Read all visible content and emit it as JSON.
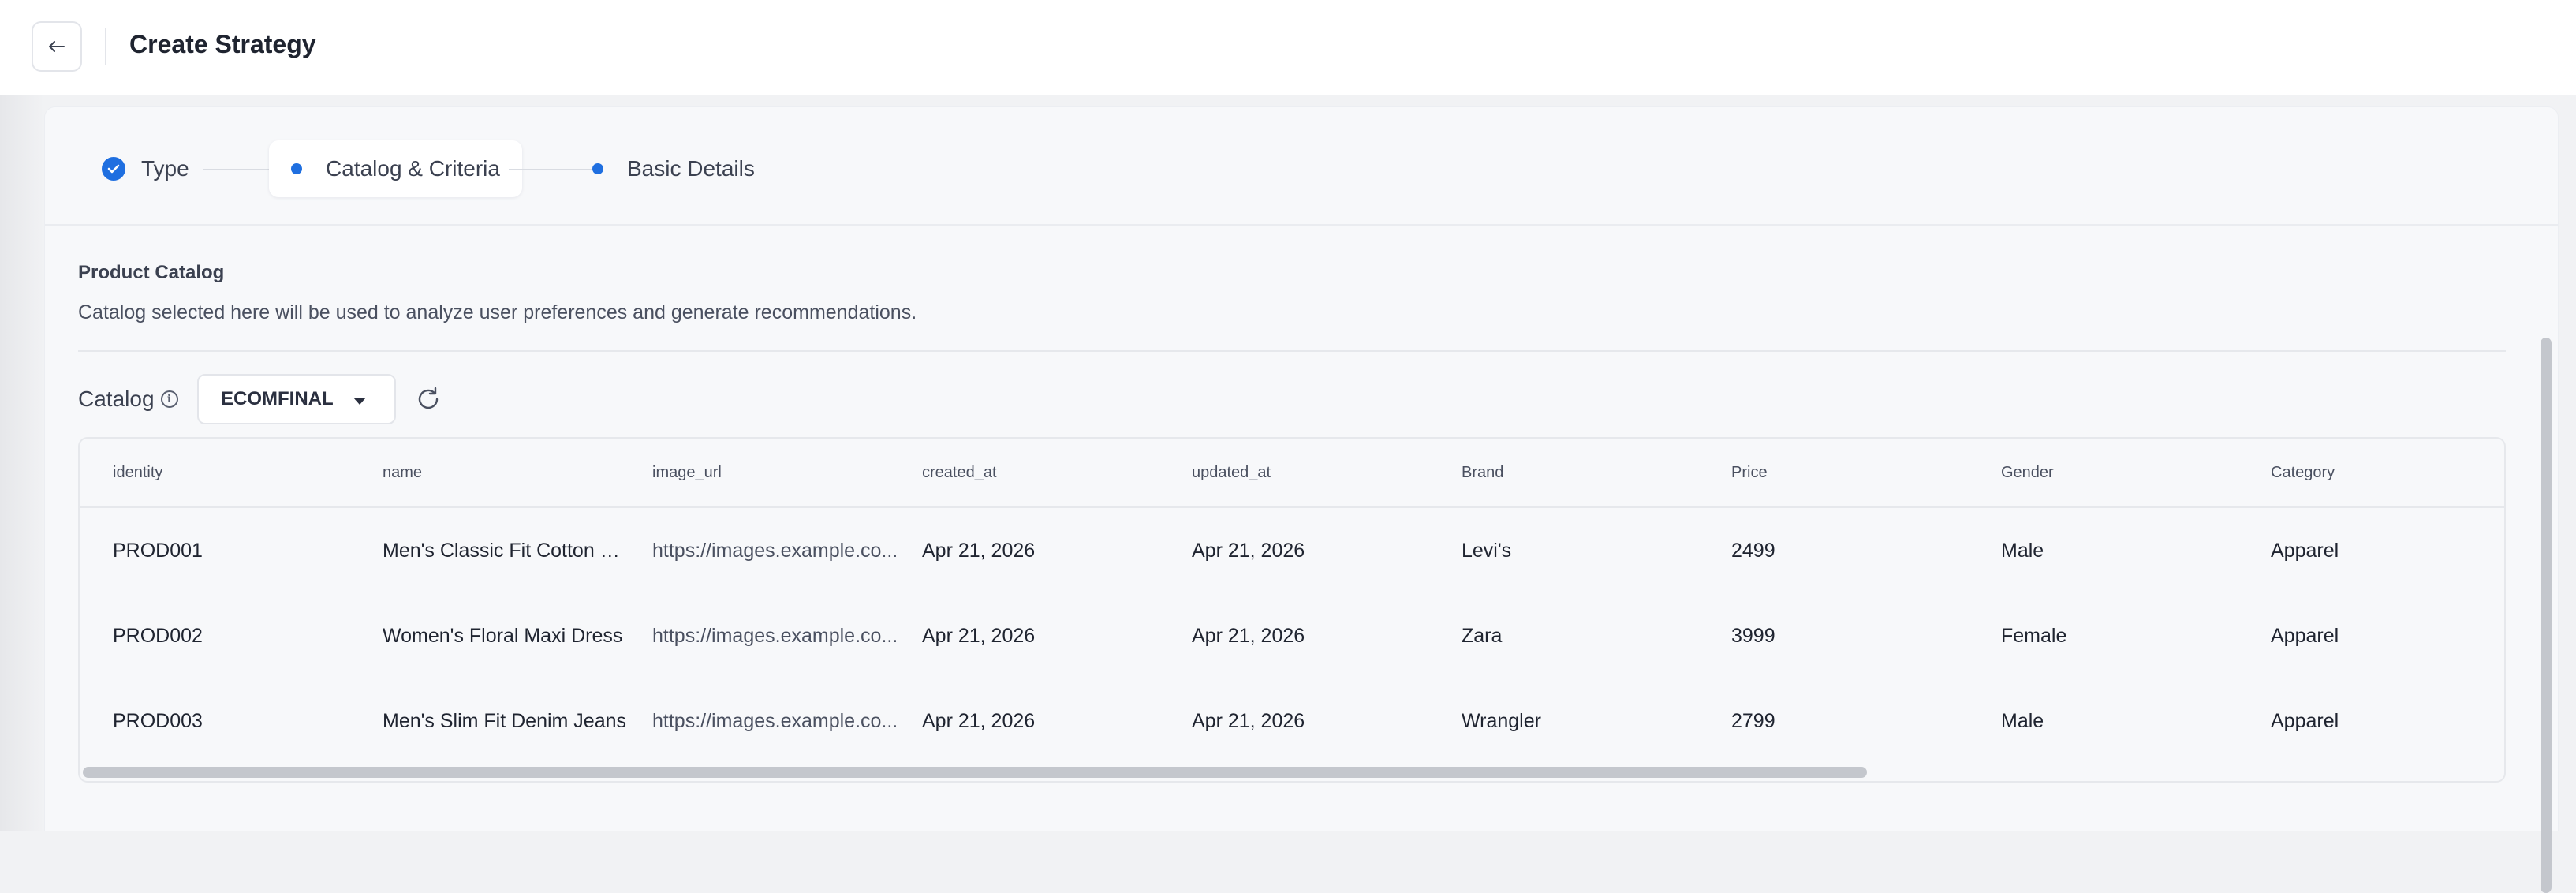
{
  "header": {
    "back_icon": "arrow-left-icon",
    "title": "Create Strategy"
  },
  "stepper": {
    "steps": [
      {
        "label": "Type",
        "status": "completed"
      },
      {
        "label": "Catalog & Criteria",
        "status": "active"
      },
      {
        "label": "Basic Details",
        "status": "pending"
      }
    ]
  },
  "product_catalog": {
    "title": "Product Catalog",
    "description": "Catalog selected here will be used to analyze user preferences and generate recommendations.",
    "catalog_label": "Catalog",
    "info_icon": "info-icon",
    "selected_catalog": "ECOMFINAL",
    "refresh_icon": "refresh-icon"
  },
  "table": {
    "columns": [
      "identity",
      "name",
      "image_url",
      "created_at",
      "updated_at",
      "Brand",
      "Price",
      "Gender",
      "Category"
    ],
    "rows": [
      [
        "PROD001",
        "Men's Classic Fit Cotton S...",
        "https://images.example.co...",
        "Apr 21, 2026",
        "Apr 21, 2026",
        "Levi's",
        "2499",
        "Male",
        "Apparel"
      ],
      [
        "PROD002",
        "Women's Floral Maxi Dress",
        "https://images.example.co...",
        "Apr 21, 2026",
        "Apr 21, 2026",
        "Zara",
        "3999",
        "Female",
        "Apparel"
      ],
      [
        "PROD003",
        "Men's Slim Fit Denim Jeans",
        "https://images.example.co...",
        "Apr 21, 2026",
        "Apr 21, 2026",
        "Wrangler",
        "2799",
        "Male",
        "Apparel"
      ]
    ]
  },
  "colors": {
    "accent": "#1f6fe0",
    "background": "#f7f8fa"
  }
}
